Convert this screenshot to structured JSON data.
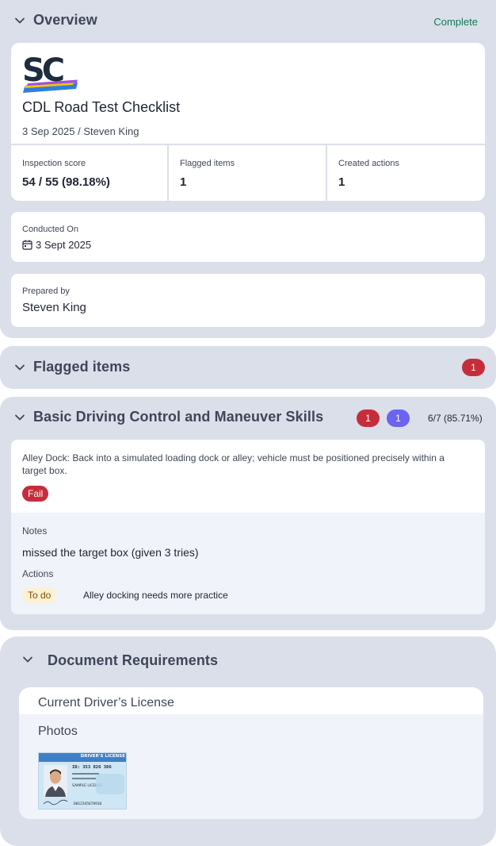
{
  "overview": {
    "title": "Overview",
    "status": "Complete",
    "logo_text": "SC",
    "doc_title": "CDL Road Test Checklist",
    "subtitle": "3 Sep 2025 / Steven King",
    "stats": [
      {
        "label": "Inspection score",
        "value": "54 / 55 (98.18%)"
      },
      {
        "label": "Flagged items",
        "value": "1"
      },
      {
        "label": "Created actions",
        "value": "1"
      }
    ],
    "conducted": {
      "label": "Conducted On",
      "value": "3 Sept 2025"
    },
    "prepared": {
      "label": "Prepared by",
      "value": "Steven King"
    }
  },
  "flagged": {
    "title": "Flagged items",
    "count": "1"
  },
  "basic": {
    "title": "Basic Driving Control and Maneuver Skills",
    "badge_red": "1",
    "badge_blue": "1",
    "score": "6/7 (85.71%)",
    "question": "Alley Dock: Back into a simulated loading dock or alley; vehicle must be positioned precisely within a target box.",
    "result": "Fail",
    "notes_label": "Notes",
    "notes": "missed the target box (given 3 tries)",
    "actions_label": "Actions",
    "action_status": "To do",
    "action_text": "Alley docking needs more practice"
  },
  "docs": {
    "title": "Document Requirements",
    "item": "Current Driver’s License",
    "photos_label": "Photos",
    "license": {
      "header": "DRIVER'S LICENSE",
      "id": "ID: 353 826 386",
      "name": "SAMPLE LICENSE",
      "number": "D012345678910"
    }
  },
  "colors": {
    "section_bg": "#dbdfea",
    "complete_green": "#0f7a52",
    "fail_red": "#c62d3a",
    "badge_blue": "#6c63f0",
    "todo_bg": "#fdf1d3"
  }
}
